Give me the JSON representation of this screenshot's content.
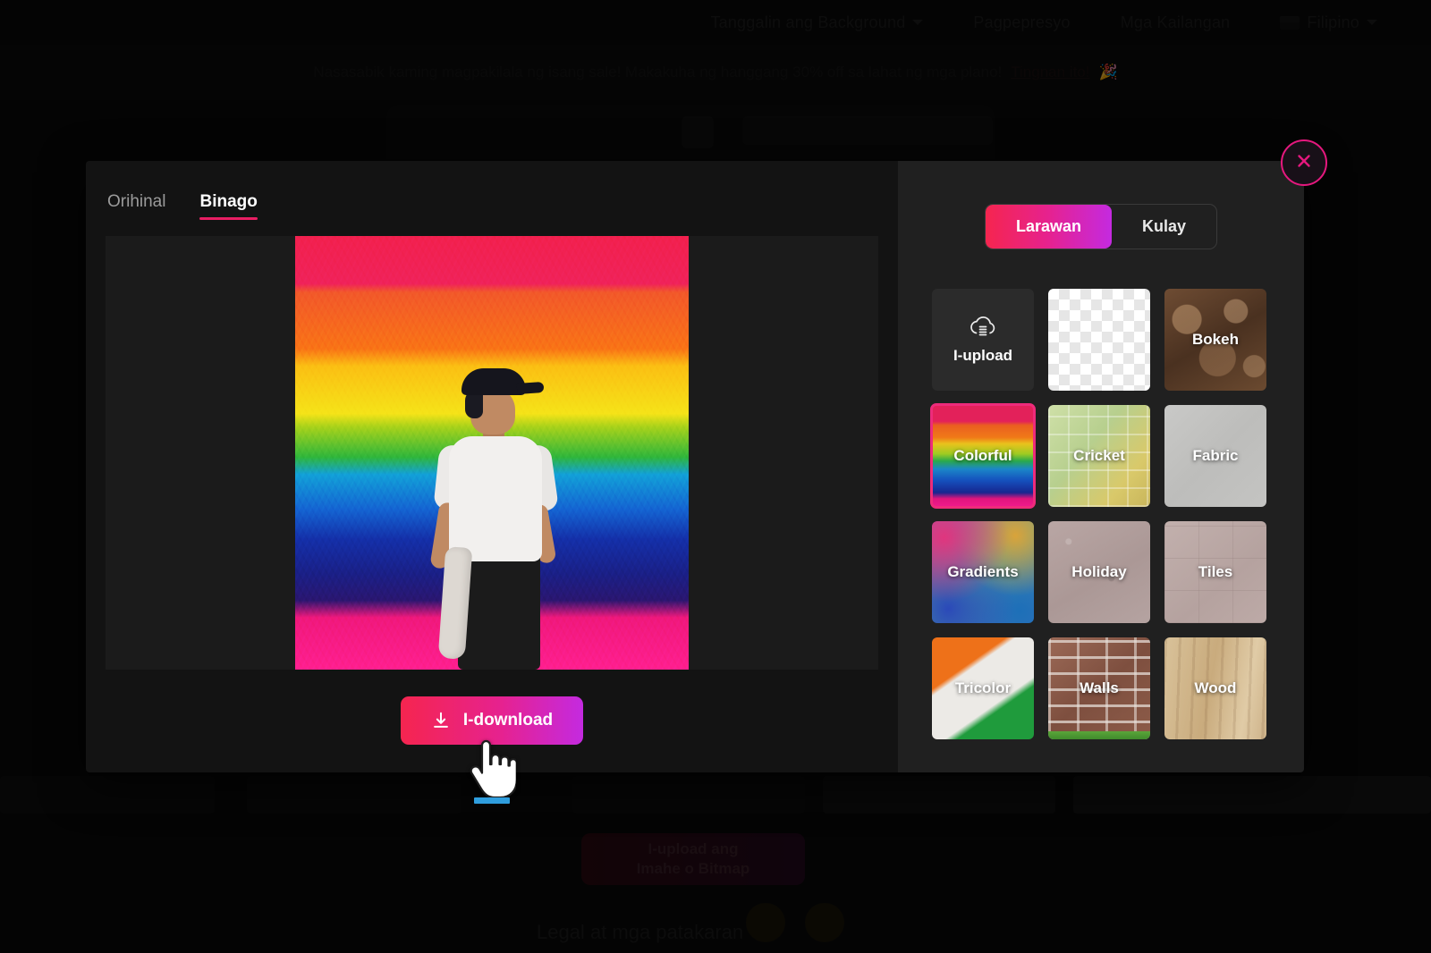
{
  "background": {
    "nav": [
      {
        "label": "Tanggalin ang Background",
        "icon": "chevron-down-icon"
      },
      {
        "label": "Pagpepresyo",
        "icon": ""
      },
      {
        "label": "Mga Kailangan",
        "icon": ""
      },
      {
        "label": "Filipino",
        "icon": "flag-icon"
      }
    ],
    "banner": {
      "text": "Nasasabik kaming magpakilala ng isang sale! Makakuha ng hanggang 30% off sa lahat ng mga plano!",
      "link": "Tingnan ito!",
      "emoji": "🎉"
    },
    "upload_button": {
      "line1": "I-upload ang",
      "line2": "Imahe o Bitmap"
    },
    "legal": "Legal  at  mga  patakaran"
  },
  "modal": {
    "tabs": [
      {
        "label": "Orihinal",
        "active": false
      },
      {
        "label": "Binago",
        "active": true
      }
    ],
    "download_button": {
      "label": "I-download",
      "icon": "download-icon"
    },
    "close_button": {
      "icon": "close-icon",
      "label": "Isara"
    },
    "segmented": [
      {
        "label": "Larawan",
        "active": true
      },
      {
        "label": "Kulay",
        "active": false
      }
    ],
    "backgrounds": [
      {
        "label": "I-upload",
        "kind": "upload",
        "icon": "cloud-upload-icon",
        "selected": false
      },
      {
        "label": "",
        "kind": "transparent",
        "icon": "",
        "selected": false
      },
      {
        "label": "Bokeh",
        "kind": "bokeh",
        "icon": "",
        "selected": false
      },
      {
        "label": "Colorful",
        "kind": "colorful",
        "icon": "",
        "selected": true
      },
      {
        "label": "Cricket",
        "kind": "cricket",
        "icon": "",
        "selected": false
      },
      {
        "label": "Fabric",
        "kind": "fabric",
        "icon": "",
        "selected": false
      },
      {
        "label": "Gradients",
        "kind": "gradients",
        "icon": "",
        "selected": false
      },
      {
        "label": "Holiday",
        "kind": "holiday",
        "icon": "",
        "selected": false
      },
      {
        "label": "Tiles",
        "kind": "tiles",
        "icon": "",
        "selected": false
      },
      {
        "label": "Tricolor",
        "kind": "tricolor",
        "icon": "",
        "selected": false
      },
      {
        "label": "Walls",
        "kind": "walls",
        "icon": "",
        "selected": false
      },
      {
        "label": "Wood",
        "kind": "wood",
        "icon": "",
        "selected": false
      }
    ],
    "preview": {
      "alt": "Taong may puting t-shirt sa harap ng makulay na pinintang rainbow na background"
    }
  },
  "colors": {
    "accent_pink": "#e91e63",
    "gradient_start": "#f5254f",
    "gradient_end": "#c42ae0",
    "selected_border": "#ee2b7b",
    "panel_left": "#131313",
    "panel_right": "#202020"
  }
}
